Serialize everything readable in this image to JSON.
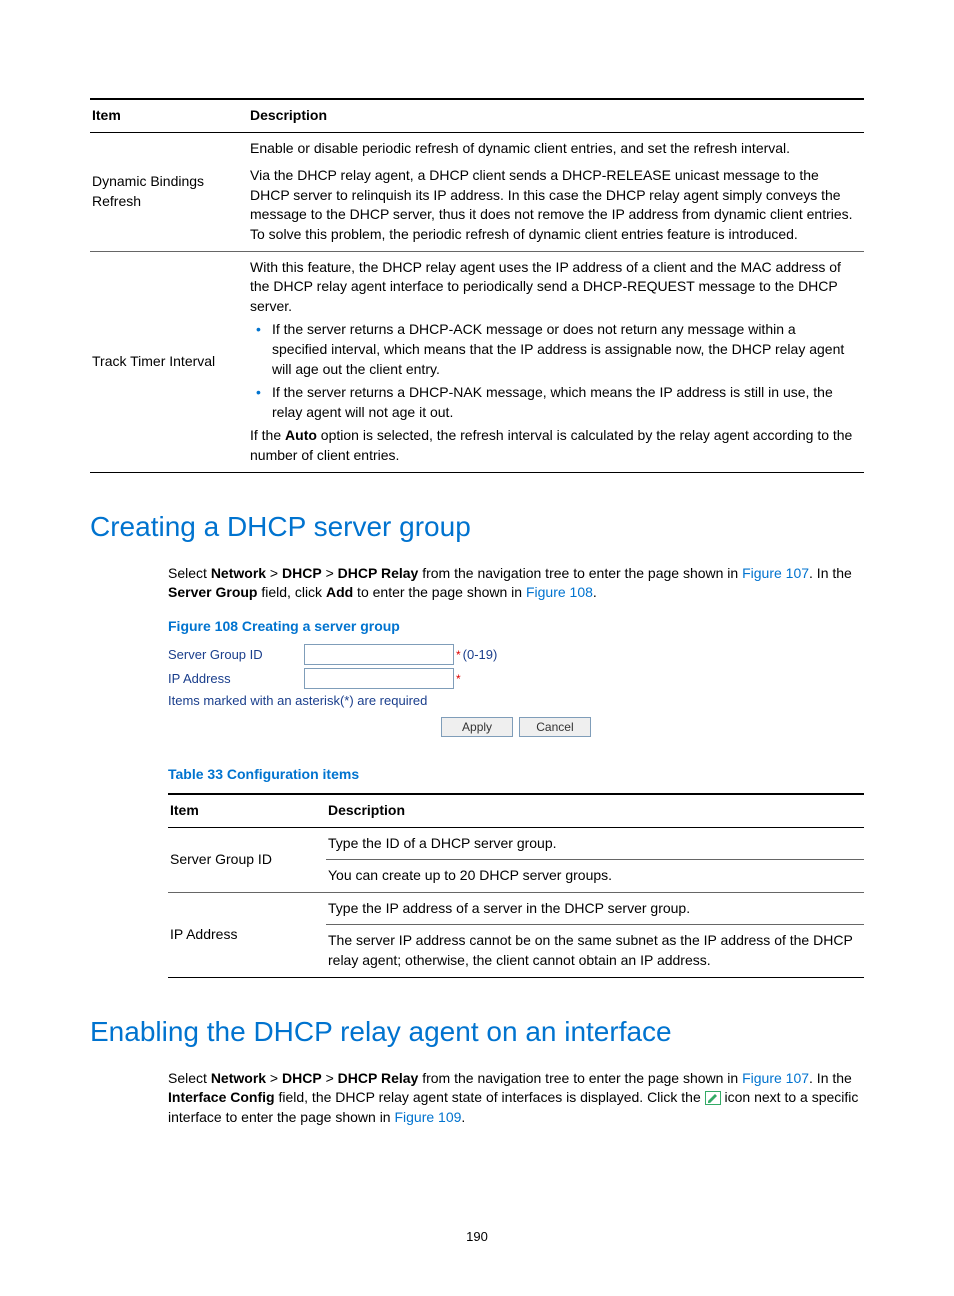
{
  "table1": {
    "head_item": "Item",
    "head_desc": "Description",
    "row1_item": "Dynamic Bindings Refresh",
    "row1_p1": "Enable or disable periodic refresh of dynamic client entries, and set the refresh interval.",
    "row1_p2": "Via the DHCP relay agent, a DHCP client sends a DHCP-RELEASE unicast message to the DHCP server to relinquish its IP address. In this case the DHCP relay agent simply conveys the message to the DHCP server, thus it does not remove the IP address from dynamic client entries. To solve this problem, the periodic refresh of dynamic client entries feature is introduced.",
    "row2_item": "Track Timer Interval",
    "row2_p1": "With this feature, the DHCP relay agent uses the IP address of a client and the MAC address of the DHCP relay agent interface to periodically send a DHCP-REQUEST message to the DHCP server.",
    "row2_b1": "If the server returns a DHCP-ACK message or does not return any message within a specified interval, which means that the IP address is assignable now, the DHCP relay agent will age out the client entry.",
    "row2_b2": "If the server returns a DHCP-NAK message, which means the IP address is still in use, the relay agent will not age it out.",
    "row2_p2a": "If the ",
    "row2_p2_bold": "Auto",
    "row2_p2b": " option is selected, the refresh interval is calculated by the relay agent according to the number of client entries."
  },
  "h2_1": "Creating a DHCP server group",
  "section1": {
    "p1a": "Select ",
    "p1_b1": "Network",
    "p1_gt1": " > ",
    "p1_b2": "DHCP",
    "p1_gt2": " > ",
    "p1_b3": "DHCP Relay",
    "p1b": " from the navigation tree to enter the page shown in ",
    "p1_link": "Figure 107",
    "p1c": ". In the ",
    "p1_b4": "Server Group",
    "p1d": " field, click ",
    "p1_b5": "Add",
    "p1e": " to enter the page shown in ",
    "p1_link2": "Figure 108",
    "p1f": "."
  },
  "fig108_title": "Figure 108 Creating a server group",
  "form": {
    "label_id": "Server Group ID",
    "hint_id": "(0-19)",
    "label_ip": "IP Address",
    "note": "Items marked with an asterisk(*) are required",
    "btn_apply": "Apply",
    "btn_cancel": "Cancel"
  },
  "table33_title": "Table 33 Configuration items",
  "table2": {
    "head_item": "Item",
    "head_desc": "Description",
    "row1_item": "Server Group ID",
    "row1_p1": "Type the ID of a DHCP server group.",
    "row1_p2": "You can create up to 20 DHCP server groups.",
    "row2_item": "IP Address",
    "row2_p1": "Type the IP address of a server in the DHCP server group.",
    "row2_p2": "The server IP address cannot be on the same subnet as the IP address of the DHCP relay agent; otherwise, the client cannot obtain an IP address."
  },
  "h2_2": "Enabling the DHCP relay agent on an interface",
  "section2": {
    "p1a": "Select ",
    "p1_b1": "Network",
    "p1_gt1": " > ",
    "p1_b2": "DHCP",
    "p1_gt2": " > ",
    "p1_b3": "DHCP Relay",
    "p1b": " from the navigation tree to enter the page shown in ",
    "p1_link": "Figure 107",
    "p1c": ". In the ",
    "p1_b4": "Interface Config",
    "p1d": " field, the DHCP relay agent state of interfaces is displayed. Click the ",
    "p1e": " icon next to a specific interface to enter the page shown in ",
    "p1_link2": "Figure 109",
    "p1f": "."
  },
  "page_number": "190"
}
